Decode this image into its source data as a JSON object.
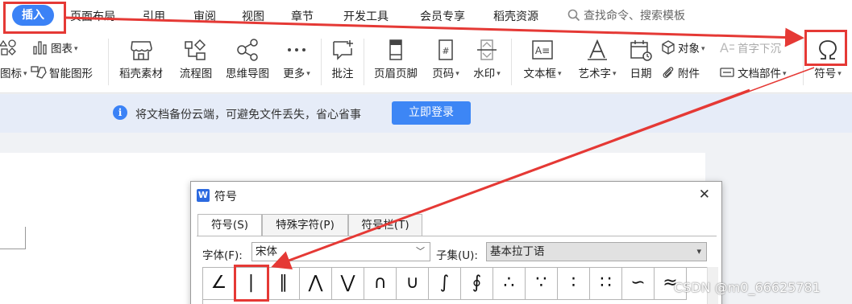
{
  "menubar": {
    "active_tab": "插入",
    "items": [
      "页面布局",
      "引用",
      "审阅",
      "视图",
      "章节",
      "开发工具",
      "会员专享",
      "稻壳资源"
    ],
    "search_placeholder": "查找命令、搜索模板"
  },
  "ribbon": {
    "partial_left_top": "",
    "partial_left_bottom": "图标",
    "chart": "图表",
    "smart_art": "智能图形",
    "docer_material": "稻壳素材",
    "flowchart": "流程图",
    "mindmap": "思维导图",
    "more": "更多",
    "comment": "批注",
    "header_footer": "页眉页脚",
    "page_number": "页码",
    "watermark": "水印",
    "textbox": "文本框",
    "wordart": "艺术字",
    "date": "日期",
    "object": "对象",
    "attachment": "附件",
    "drop_cap": "首字下沉",
    "doc_parts": "文档部件",
    "symbol": "符号"
  },
  "notice": {
    "text": "将文档备份云端，可避免文件丢失，省心省事",
    "login_button": "立即登录"
  },
  "dialog": {
    "title": "符号",
    "tabs": [
      "符号(S)",
      "特殊字符(P)",
      "符号栏(T)"
    ],
    "font_label": "字体(F):",
    "font_value": "宋体",
    "subset_label": "子集(U):",
    "subset_value": "基本拉丁语",
    "symbols": [
      "∠",
      "|",
      "∥",
      "⋀",
      "⋁",
      "∩",
      "∪",
      "∫",
      "∮",
      "∴",
      "∵",
      "∶",
      "∷",
      "∽",
      "≈"
    ],
    "selected_index": 1
  },
  "watermark": "CSDN @m0_66625781",
  "colors": {
    "accent": "#3b82f6",
    "annotation_red": "#e53935",
    "notice_bg": "#e6ecf8"
  }
}
